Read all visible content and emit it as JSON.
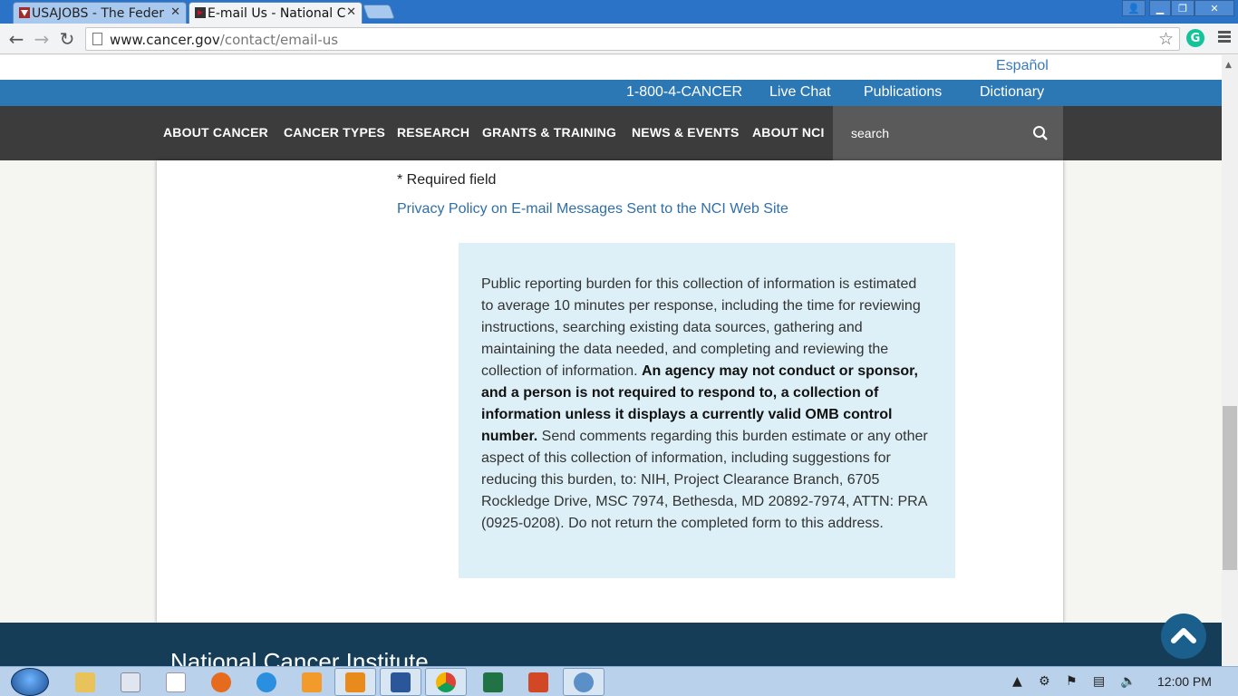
{
  "browser": {
    "tabs": [
      {
        "label": "USAJOBS - The Feder",
        "active": false
      },
      {
        "label": "E-mail Us - National C",
        "active": true
      }
    ],
    "url_domain": "www.cancer.gov",
    "url_path": "/contact/email-us"
  },
  "site": {
    "language_link": "Español",
    "top_links": [
      "1-800-4-CANCER",
      "Live Chat",
      "Publications",
      "Dictionary"
    ],
    "nav": [
      "ABOUT CANCER",
      "CANCER TYPES",
      "RESEARCH",
      "GRANTS & TRAINING",
      "NEWS & EVENTS",
      "ABOUT NCI"
    ],
    "search_placeholder": "search"
  },
  "content": {
    "required_note": "* Required field",
    "privacy_link": "Privacy Policy on E-mail Messages Sent to the NCI Web Site",
    "pra_text_1": "Public reporting burden for this collection of information is estimated to average 10 minutes per response, including the time for reviewing instructions, searching existing data sources, gathering and maintaining the data needed, and completing and reviewing the collection of information. ",
    "pra_bold": "An agency may not conduct or sponsor, and a person is not required to respond to, a collection of information unless it displays a currently valid OMB control number.",
    "pra_text_2": " Send comments regarding this burden estimate or any other aspect of this collection of information, including suggestions for reducing this burden, to: NIH, Project Clearance Branch, 6705 Rockledge Drive, MSC 7974, Bethesda, MD 20892-7974, ATTN: PRA (0925-0208). Do not return the completed form to this address."
  },
  "footer": {
    "title": "National Cancer Institute"
  },
  "taskbar": {
    "clock": "12:00 PM"
  }
}
